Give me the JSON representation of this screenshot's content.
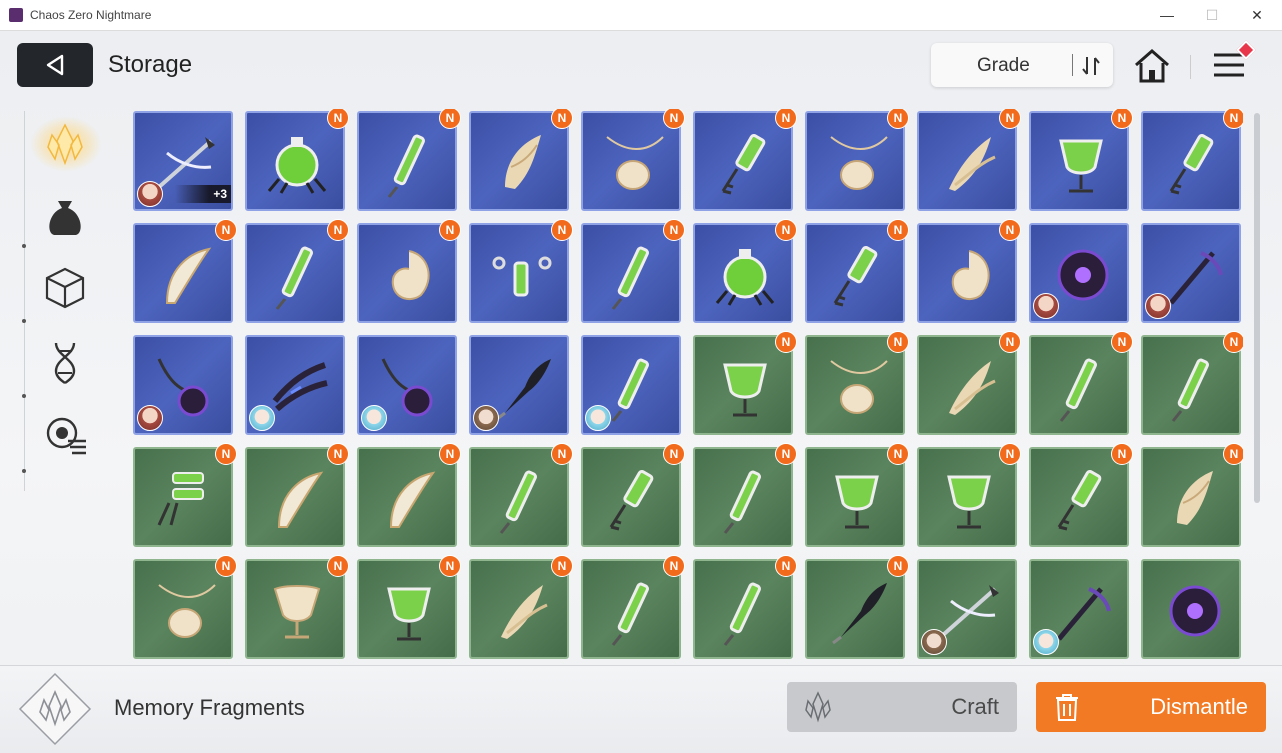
{
  "window": {
    "title": "Chaos Zero Nightmare",
    "minimize": "—",
    "maximize": "☐",
    "close": "✕"
  },
  "header": {
    "title": "Storage",
    "sort_label": "Grade"
  },
  "sidebar": {
    "items": [
      {
        "name": "memory-fragments-tab",
        "active": true
      },
      {
        "name": "bag-tab",
        "active": false
      },
      {
        "name": "cube-tab",
        "active": false
      },
      {
        "name": "dna-tab",
        "active": false
      },
      {
        "name": "skin-tab",
        "active": false
      }
    ]
  },
  "colors": {
    "blue_tile": "#4558b0",
    "green_tile": "#507a55",
    "new_badge": "#f26a1b",
    "dismantle": "#f37a24"
  },
  "items": [
    {
      "rarity": "blue",
      "icon": "scythe",
      "new": false,
      "owner": "red",
      "upgrade": "+3"
    },
    {
      "rarity": "blue",
      "icon": "flask-spider",
      "new": true
    },
    {
      "rarity": "blue",
      "icon": "syringe",
      "new": true
    },
    {
      "rarity": "blue",
      "icon": "feather-mask",
      "new": true
    },
    {
      "rarity": "blue",
      "icon": "pendant",
      "new": true
    },
    {
      "rarity": "blue",
      "icon": "key-vial",
      "new": true
    },
    {
      "rarity": "blue",
      "icon": "pendant",
      "new": true
    },
    {
      "rarity": "blue",
      "icon": "feathers",
      "new": true
    },
    {
      "rarity": "blue",
      "icon": "goblet",
      "new": true
    },
    {
      "rarity": "blue",
      "icon": "key-vial",
      "new": true
    },
    {
      "rarity": "blue",
      "icon": "bow-blade",
      "new": true
    },
    {
      "rarity": "blue",
      "icon": "syringe",
      "new": true
    },
    {
      "rarity": "blue",
      "icon": "shell",
      "new": true
    },
    {
      "rarity": "blue",
      "icon": "chain-vial",
      "new": true
    },
    {
      "rarity": "blue",
      "icon": "syringe",
      "new": true
    },
    {
      "rarity": "blue",
      "icon": "flask-spider",
      "new": true
    },
    {
      "rarity": "blue",
      "icon": "key-vial",
      "new": true
    },
    {
      "rarity": "blue",
      "icon": "shell",
      "new": true
    },
    {
      "rarity": "blue",
      "icon": "dark-orb",
      "new": false,
      "owner": "red"
    },
    {
      "rarity": "blue",
      "icon": "dark-staff",
      "new": false,
      "owner": "red"
    },
    {
      "rarity": "blue",
      "icon": "dark-chain",
      "new": false,
      "owner": "red"
    },
    {
      "rarity": "blue",
      "icon": "dark-claw",
      "new": false,
      "owner": "cyan"
    },
    {
      "rarity": "blue",
      "icon": "dark-chain",
      "new": false,
      "owner": "cyan"
    },
    {
      "rarity": "blue",
      "icon": "dark-wing",
      "new": false,
      "owner": "brown"
    },
    {
      "rarity": "blue",
      "icon": "syringe",
      "new": false,
      "owner": "cyan"
    },
    {
      "rarity": "green",
      "icon": "goblet",
      "new": true
    },
    {
      "rarity": "green",
      "icon": "pendant",
      "new": true
    },
    {
      "rarity": "green",
      "icon": "feathers",
      "new": true
    },
    {
      "rarity": "green",
      "icon": "syringe",
      "new": true
    },
    {
      "rarity": "green",
      "icon": "syringe",
      "new": true
    },
    {
      "rarity": "green",
      "icon": "vial-claw",
      "new": true
    },
    {
      "rarity": "green",
      "icon": "bow-blade",
      "new": true
    },
    {
      "rarity": "green",
      "icon": "bow-blade",
      "new": true
    },
    {
      "rarity": "green",
      "icon": "syringe",
      "new": true
    },
    {
      "rarity": "green",
      "icon": "key-vial",
      "new": true
    },
    {
      "rarity": "green",
      "icon": "syringe",
      "new": true
    },
    {
      "rarity": "green",
      "icon": "goblet",
      "new": true
    },
    {
      "rarity": "green",
      "icon": "goblet",
      "new": true
    },
    {
      "rarity": "green",
      "icon": "key-vial",
      "new": true
    },
    {
      "rarity": "green",
      "icon": "feather-mask",
      "new": true
    },
    {
      "rarity": "green",
      "icon": "pendant",
      "new": true
    },
    {
      "rarity": "green",
      "icon": "chalice",
      "new": true
    },
    {
      "rarity": "green",
      "icon": "goblet",
      "new": true
    },
    {
      "rarity": "green",
      "icon": "feathers",
      "new": true
    },
    {
      "rarity": "green",
      "icon": "syringe",
      "new": true
    },
    {
      "rarity": "green",
      "icon": "syringe",
      "new": true
    },
    {
      "rarity": "green",
      "icon": "dark-wing",
      "new": true
    },
    {
      "rarity": "green",
      "icon": "scythe",
      "new": false,
      "owner": "brown"
    },
    {
      "rarity": "green",
      "icon": "dark-staff",
      "new": false,
      "owner": "cyan"
    },
    {
      "rarity": "green",
      "icon": "dark-orb",
      "new": false
    }
  ],
  "badge_text": "N",
  "footer": {
    "section_label": "Memory Fragments",
    "craft_label": "Craft",
    "dismantle_label": "Dismantle"
  }
}
